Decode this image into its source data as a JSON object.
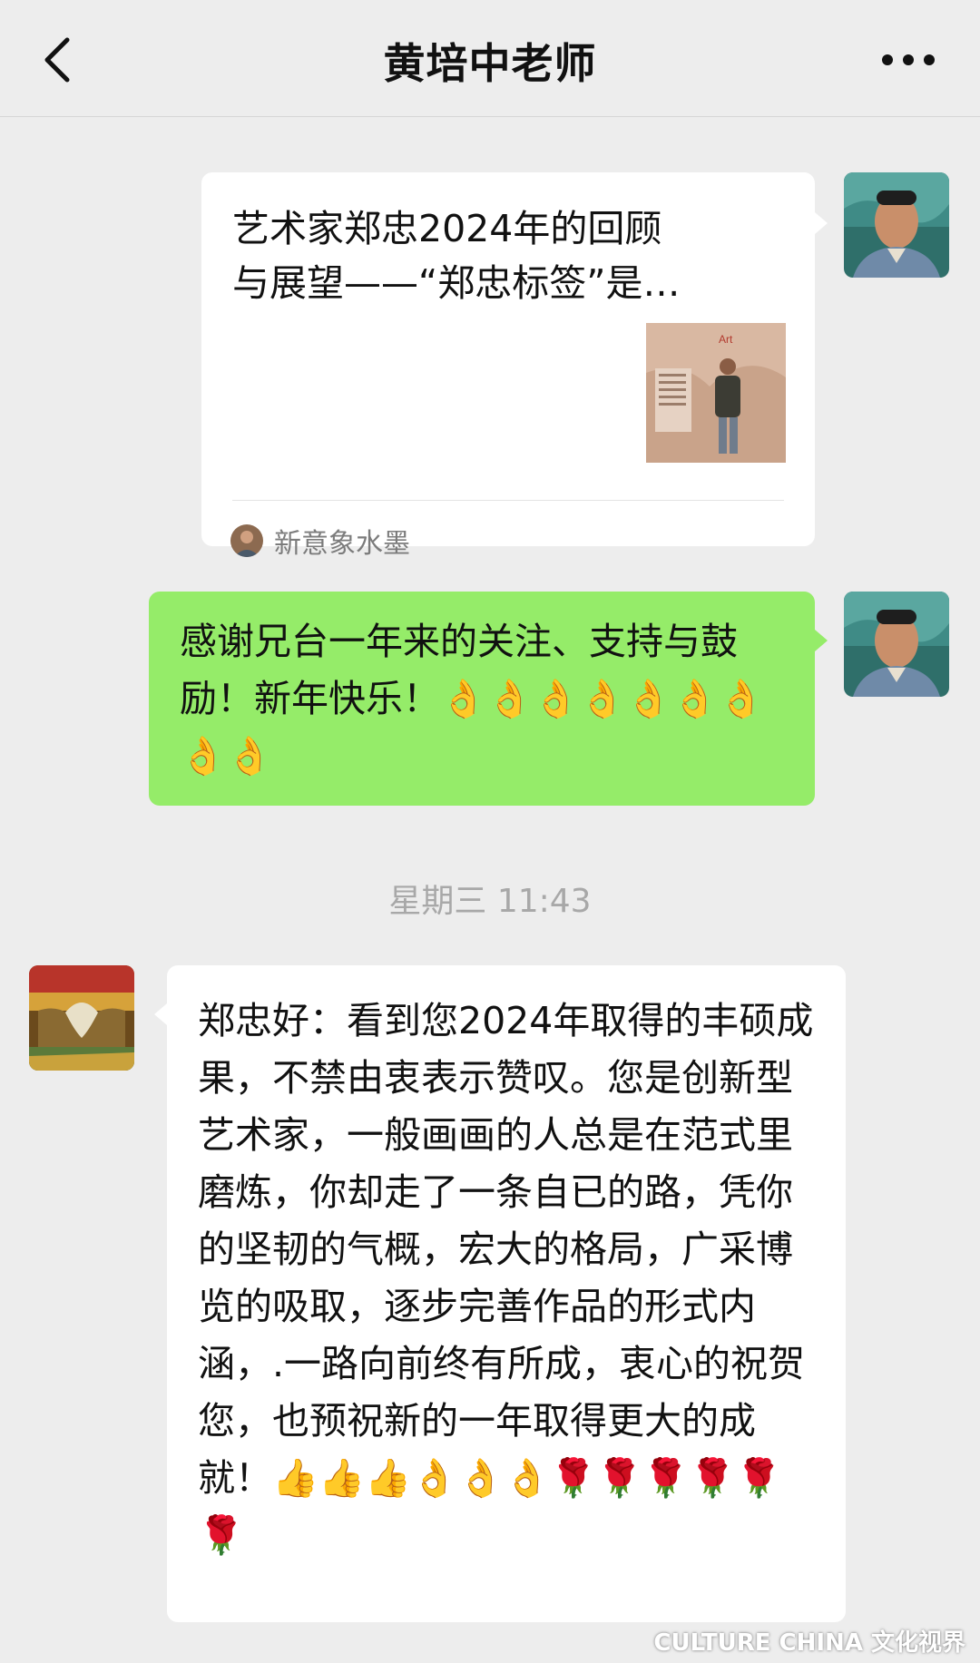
{
  "header": {
    "title": "黄培中老师",
    "back_icon": "chevron-left-icon",
    "more_icon": "more-dots-icon"
  },
  "messages": [
    {
      "type": "link-card",
      "side": "right",
      "title": "艺术家郑忠2024年的回顾与展望——“郑忠标签”是…",
      "source": "新意象水墨"
    },
    {
      "type": "text",
      "side": "right",
      "text": "感谢兄台一年来的关注、支持与鼓励！新年快乐！👌👌👌👌👌👌👌👌👌"
    },
    {
      "type": "timestamp",
      "text": "星期三 11:43"
    },
    {
      "type": "text",
      "side": "left",
      "text": "郑忠好：看到您2024年取得的丰硕成果，不禁由衷表示赞叹。您是创新型艺术家，一般画画的人总是在范式里磨炼，你却走了一条自已的路，凭你的坚韧的气概，宏大的格局，广采博览的吸取，逐步完善作品的形式内涵，.一路向前终有所成，衷心的祝贺您，也预祝新的一年取得更大的成就！👍👍👍👌👌👌🌹🌹🌹🌹🌹🌹"
    }
  ],
  "watermark": "CULTURE CHINA 文化视界",
  "colors": {
    "background": "#ededed",
    "bubble_sent": "#95ec69",
    "bubble_received": "#ffffff",
    "timestamp": "#a8a8a8"
  }
}
